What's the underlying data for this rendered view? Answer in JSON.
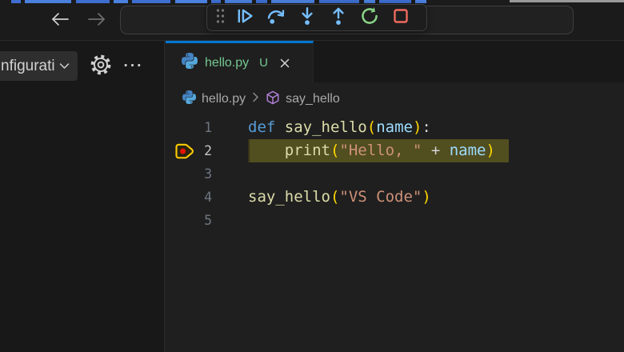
{
  "colors": {
    "accent_blue": "#0078d4",
    "debug_blue": "#75beff",
    "debug_green": "#89d185",
    "debug_red": "#ef6b5e",
    "breakpoint_gold": "#ffcc00",
    "breakpoint_red": "#e51400",
    "tab_green": "#73c991",
    "line_highlight": "#514e20",
    "keyword": "#569cd6",
    "function": "#dcdcaa",
    "bracket": "#ffd700",
    "variable": "#9cdcfe",
    "string": "#ce9178",
    "text": "#d4d4d4"
  },
  "titlebar": {
    "debug_toolbar_buttons": [
      "gripper",
      "continue",
      "step-over",
      "step-into",
      "step-out",
      "restart",
      "stop"
    ]
  },
  "sidebar": {
    "config_dropdown_label": "nfigurati",
    "more_actions_label": "···"
  },
  "editor": {
    "tab": {
      "file": "hello.py",
      "git_badge": "U"
    },
    "breadcrumb": {
      "file": "hello.py",
      "symbol": "say_hello"
    },
    "code": {
      "lines": [
        {
          "num": "1",
          "current": false,
          "breakpoint": false,
          "tokens": [
            [
              "def",
              "keyword"
            ],
            [
              " ",
              "text"
            ],
            [
              "say_hello",
              "function"
            ],
            [
              "(",
              "bracket"
            ],
            [
              "name",
              "variable"
            ],
            [
              ")",
              "bracket"
            ],
            [
              ":",
              "text"
            ]
          ]
        },
        {
          "num": "2",
          "current": true,
          "breakpoint": true,
          "tokens": [
            [
              "    ",
              "text"
            ],
            [
              "print",
              "function"
            ],
            [
              "(",
              "bracket"
            ],
            [
              "\"Hello, \"",
              "string"
            ],
            [
              " + ",
              "text"
            ],
            [
              "name",
              "variable"
            ],
            [
              ")",
              "bracket"
            ]
          ]
        },
        {
          "num": "3",
          "current": false,
          "breakpoint": false,
          "tokens": []
        },
        {
          "num": "4",
          "current": false,
          "breakpoint": false,
          "tokens": [
            [
              "say_hello",
              "function"
            ],
            [
              "(",
              "bracket"
            ],
            [
              "\"VS Code\"",
              "string"
            ],
            [
              ")",
              "bracket"
            ]
          ]
        },
        {
          "num": "5",
          "current": false,
          "breakpoint": false,
          "tokens": []
        }
      ]
    }
  }
}
